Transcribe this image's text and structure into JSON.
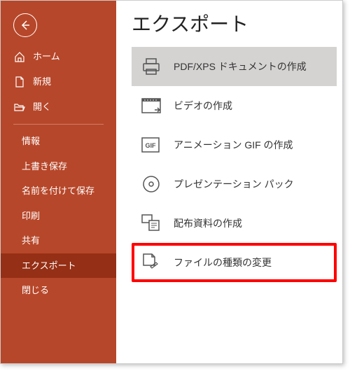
{
  "sidebar": {
    "home": "ホーム",
    "new": "新規",
    "open": "開く",
    "items": [
      "情報",
      "上書き保存",
      "名前を付けて保存",
      "印刷",
      "共有",
      "エクスポート",
      "閉じる"
    ],
    "activeIndex": 5
  },
  "main": {
    "title": "エクスポート",
    "options": [
      "PDF/XPS ドキュメントの作成",
      "ビデオの作成",
      "アニメーション GIF の作成",
      "プレゼンテーション パック",
      "配布資料の作成",
      "ファイルの種類の変更"
    ],
    "selectedIndex": 0,
    "highlightedIndex": 5
  }
}
